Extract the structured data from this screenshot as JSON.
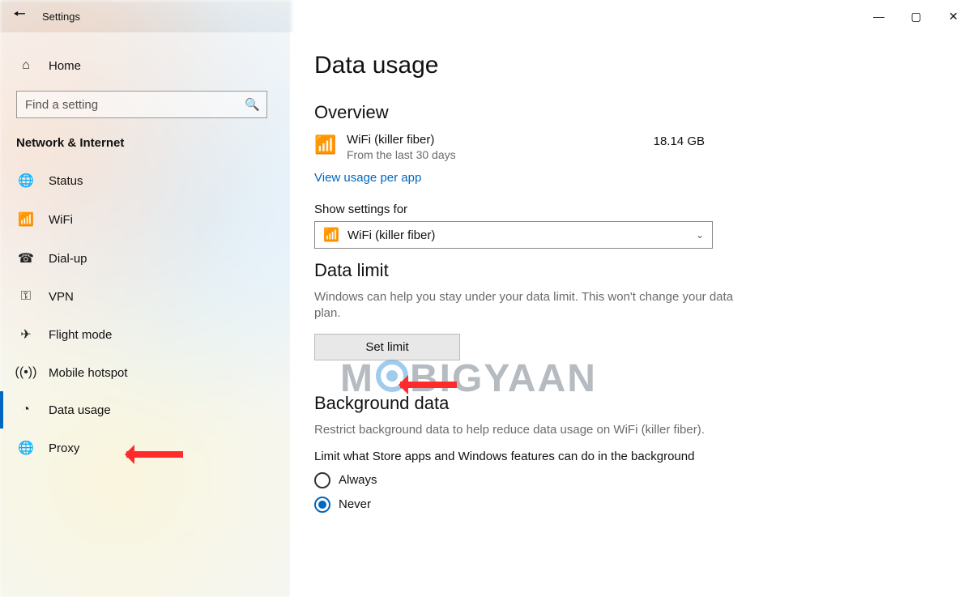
{
  "window": {
    "title": "Settings"
  },
  "sidebar": {
    "home_label": "Home",
    "search_placeholder": "Find a setting",
    "section_label": "Network & Internet",
    "items": [
      {
        "icon": "globe-icon",
        "label": "Status"
      },
      {
        "icon": "wifi-icon",
        "label": "WiFi"
      },
      {
        "icon": "dialup-icon",
        "label": "Dial-up"
      },
      {
        "icon": "vpn-icon",
        "label": "VPN"
      },
      {
        "icon": "airplane-icon",
        "label": "Flight mode"
      },
      {
        "icon": "hotspot-icon",
        "label": "Mobile hotspot"
      },
      {
        "icon": "data-icon",
        "label": "Data usage"
      },
      {
        "icon": "proxy-icon",
        "label": "Proxy"
      }
    ],
    "selected_index": 6
  },
  "main": {
    "page_title": "Data usage",
    "overview": {
      "heading": "Overview",
      "network_name": "WiFi (killer fiber)",
      "period": "From the last 30 days",
      "amount": "18.14 GB",
      "link": "View usage per app"
    },
    "show_settings": {
      "label": "Show settings for",
      "selected": "WiFi (killer fiber)"
    },
    "data_limit": {
      "heading": "Data limit",
      "description": "Windows can help you stay under your data limit. This won't change your data plan.",
      "button": "Set limit"
    },
    "background": {
      "heading": "Background data",
      "description": "Restrict background data to help reduce data usage on WiFi (killer fiber).",
      "question": "Limit what Store apps and Windows features can do in the background",
      "options": [
        "Always",
        "Never"
      ],
      "selected": "Never"
    }
  },
  "watermark": {
    "prefix": "M",
    "suffix": "BIGYAAN"
  }
}
